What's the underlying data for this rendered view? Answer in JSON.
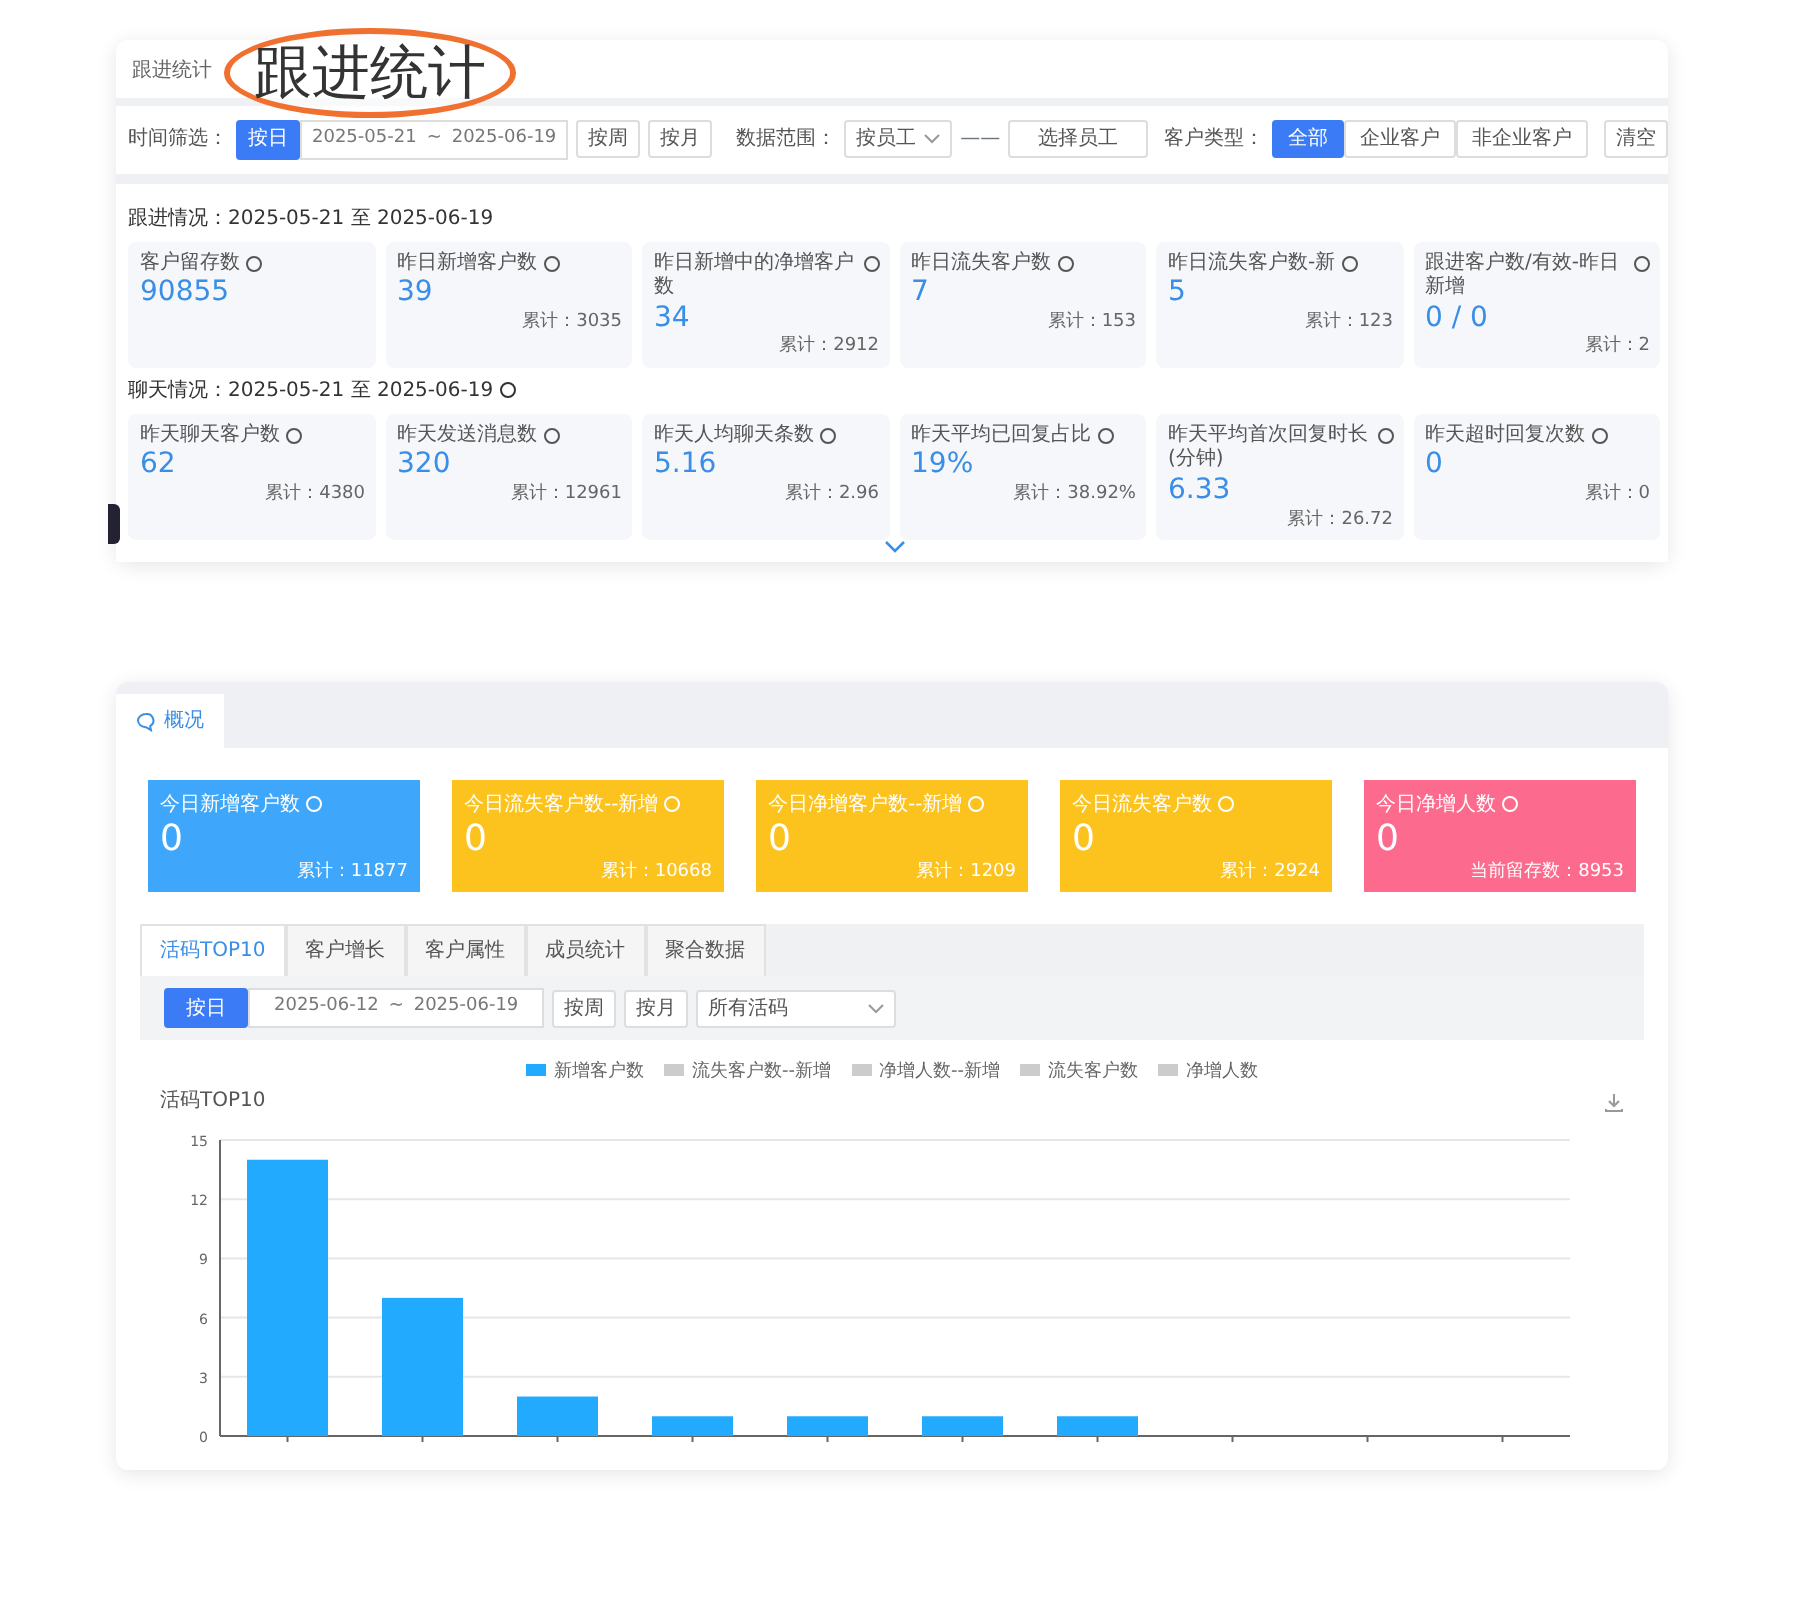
{
  "stamp": {
    "title": "跟进统计"
  },
  "follow_panel": {
    "title": "跟进统计",
    "filters": {
      "time_label": "时间筛选：",
      "time_modes": [
        {
          "label": "按日",
          "selected": true
        }
      ],
      "date_from": "2025-05-21",
      "date_sep": "~",
      "date_to": "2025-06-19",
      "extra_modes": [
        {
          "label": "按周",
          "selected": false
        },
        {
          "label": "按月",
          "selected": false
        }
      ],
      "range_label": "数据范围：",
      "range_value": "按员工",
      "range_dash": "——",
      "staff_button": "选择员工",
      "type_label": "客户类型：",
      "types": [
        {
          "label": "全部",
          "selected": true
        },
        {
          "label": "企业客户",
          "selected": false
        },
        {
          "label": "非企业客户",
          "selected": false
        }
      ],
      "clear": "清空"
    },
    "follow_heading": "跟进情况：2025-05-21 至 2025-06-19",
    "follow_cards": [
      {
        "label": "客户留存数",
        "value": "90855"
      },
      {
        "label": "昨日新增客户数",
        "value": "39",
        "total": "累计：3035"
      },
      {
        "label": "昨日新增中的净增客户数",
        "value": "34",
        "total": "累计：2912"
      },
      {
        "label": "昨日流失客户数",
        "value": "7",
        "total": "累计：153"
      },
      {
        "label": "昨日流失客户数-新",
        "value": "5",
        "total": "累计：123"
      },
      {
        "label": "跟进客户数/有效-昨日新增",
        "value": "0 / 0",
        "total": "累计：2"
      }
    ],
    "chat_heading": "聊天情况：2025-05-21 至 2025-06-19",
    "chat_cards": [
      {
        "label": "昨天聊天客户数",
        "value": "62",
        "total": "累计：4380"
      },
      {
        "label": "昨天发送消息数",
        "value": "320",
        "total": "累计：12961"
      },
      {
        "label": "昨天人均聊天条数",
        "value": "5.16",
        "total": "累计：2.96"
      },
      {
        "label": "昨天平均已回复占比",
        "value": "19%",
        "total": "累计：38.92%"
      },
      {
        "label": "昨天平均首次回复时长(分钟)",
        "value": "6.33",
        "total": "累计：26.72"
      },
      {
        "label": "昨天超时回复次数",
        "value": "0",
        "total": "累计：0"
      }
    ]
  },
  "overview_panel": {
    "tab": "概况",
    "cards": [
      {
        "label": "今日新增客户数",
        "value": "0",
        "total": "累计：11877",
        "color": "#3fa7fb"
      },
      {
        "label": "今日流失客户数--新增",
        "value": "0",
        "total": "累计：10668",
        "color": "#fcc31f"
      },
      {
        "label": "今日净增客户数--新增",
        "value": "0",
        "total": "累计：1209",
        "color": "#fcc31f"
      },
      {
        "label": "今日流失客户数",
        "value": "0",
        "total": "累计：2924",
        "color": "#fcc31f"
      },
      {
        "label": "今日净增人数",
        "value": "0",
        "total": "当前留存数：8953",
        "color": "#fc6a8e"
      }
    ],
    "tabs": [
      {
        "label": "活码TOP10",
        "selected": true
      },
      {
        "label": "客户增长",
        "selected": false
      },
      {
        "label": "客户属性",
        "selected": false
      },
      {
        "label": "成员统计",
        "selected": false
      },
      {
        "label": "聚合数据",
        "selected": false
      }
    ],
    "filters": {
      "modes": [
        {
          "label": "按日",
          "selected": true
        }
      ],
      "date_from": "2025-06-12",
      "date_sep": "~",
      "date_to": "2025-06-19",
      "extra_modes": [
        {
          "label": "按周",
          "selected": false
        },
        {
          "label": "按月",
          "selected": false
        }
      ],
      "code_select": "所有活码"
    },
    "legend": [
      {
        "name": "流失客户数--新增",
        "on": false
      },
      {
        "name": "净增人数--新增",
        "on": false
      },
      {
        "name": "流失客户数",
        "on": false
      },
      {
        "name": "净增人数",
        "on": false
      }
    ],
    "chart_data": {
      "type": "bar",
      "title": "活码TOP10",
      "grid": true,
      "ylim": [
        0,
        15
      ],
      "yticks": [
        0,
        3,
        6,
        9,
        12,
        15
      ],
      "series": [
        {
          "name": "新增客户数",
          "color": "#22aaff",
          "values": [
            14,
            7,
            2,
            1,
            1,
            1,
            1,
            0,
            0,
            0
          ]
        }
      ]
    }
  }
}
